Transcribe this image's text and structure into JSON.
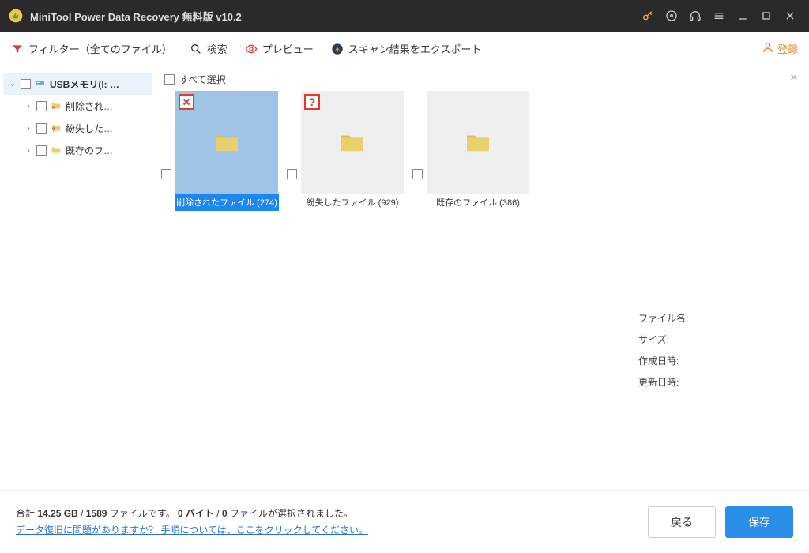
{
  "titlebar": {
    "title": "MiniTool Power Data Recovery 無料版 v10.2"
  },
  "toolbar": {
    "filter": "フィルター（全てのファイル）",
    "search": "検索",
    "preview": "プレビュー",
    "export": "スキャン結果をエクスポート",
    "register": "登録"
  },
  "tree": {
    "root_label": "USBメモリ(I: …",
    "items": [
      {
        "label": "削除され…",
        "icon": "x"
      },
      {
        "label": "紛失した…",
        "icon": "q"
      },
      {
        "label": "既存のフ…",
        "icon": "none"
      }
    ]
  },
  "content": {
    "select_all": "すべて選択",
    "tiles": [
      {
        "label": "削除されたファイル (274)",
        "badge": "x",
        "selected": true
      },
      {
        "label": "紛失したファイル (929)",
        "badge": "q",
        "selected": false
      },
      {
        "label": "既存のファイル (386)",
        "badge": "",
        "selected": false
      }
    ]
  },
  "details": {
    "filename_label": "ファイル名:",
    "size_label": "サイズ:",
    "created_label": "作成日時:",
    "modified_label": "更新日時:"
  },
  "footer": {
    "status_pre": "合計 ",
    "total_size": "14.25 GB",
    "status_mid1": " / ",
    "total_files": "1589",
    "status_mid2": "ファイルです。  ",
    "sel_bytes": "0 バイト",
    "status_mid3": "  /  ",
    "sel_files": "0",
    "status_post": " ファイルが選択されました。",
    "help_link": "データ復旧に問題がありますか？ 手順については、ここをクリックしてください。",
    "back": "戻る",
    "save": "保存"
  }
}
